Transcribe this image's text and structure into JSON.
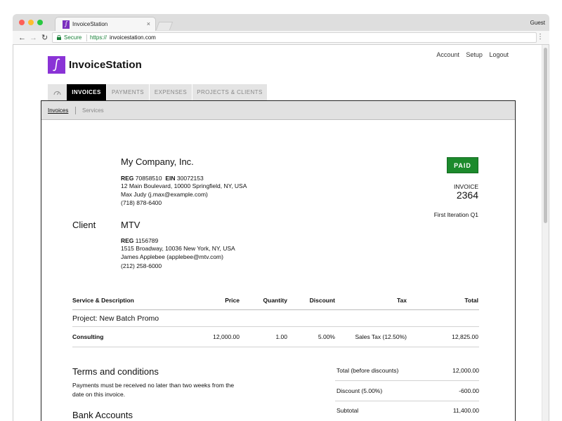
{
  "browser": {
    "tab_title": "InvoiceStation",
    "tab_close": "×",
    "profile": "Guest",
    "secure_label": "Secure",
    "url_scheme": "https://",
    "url_host": "invoicestation.com"
  },
  "app": {
    "brand": "InvoiceStation",
    "logo_glyph": "∫",
    "top_links": [
      "Account",
      "Setup",
      "Logout"
    ],
    "tabs": [
      "INVOICES",
      "PAYMENTS",
      "EXPENSES",
      "PROJECTS & CLIENTS"
    ],
    "subnav": [
      "Invoices",
      "Services"
    ]
  },
  "invoice": {
    "status": "PAID",
    "label": "INVOICE",
    "number": "2364",
    "title": "First Iteration Q1",
    "company": {
      "name": "My Company, Inc.",
      "reg_label": "REG",
      "reg": "70858510",
      "ein_label": "EIN",
      "ein": "30072153",
      "address": "12 Main Boulevard, 10000 Springfield, NY, USA",
      "contact": "Max Judy (j.max@example.com)",
      "phone": "(718) 878-6400"
    },
    "client_label": "Client",
    "client": {
      "name": "MTV",
      "reg_label": "REG",
      "reg": "1156789",
      "address": "1515 Broadway, 10036 New York, NY, USA",
      "contact": "James Applebee (applebee@mtv.com)",
      "phone": "(212) 258-6000"
    },
    "table": {
      "headers": {
        "service": "Service & Description",
        "price": "Price",
        "quantity": "Quantity",
        "discount": "Discount",
        "tax": "Tax",
        "total": "Total"
      },
      "project": "Project: New Batch Promo",
      "rows": [
        {
          "service": "Consulting",
          "price": "12,000.00",
          "quantity": "1.00",
          "discount": "5.00%",
          "tax": "Sales Tax (12.50%)",
          "total": "12,825.00"
        }
      ]
    },
    "terms": {
      "title": "Terms and conditions",
      "body": "Payments must be received no later than two weeks from the date on this invoice."
    },
    "bank_title": "Bank Accounts",
    "summary": [
      {
        "label": "Total (before discounts)",
        "value": "12,000.00"
      },
      {
        "label": "Discount (5.00%)",
        "value": "-600.00"
      },
      {
        "label": "Subtotal",
        "value": "11,400.00"
      }
    ]
  },
  "colors": {
    "brand_purple": "#8a33d6",
    "paid_green": "#1c8a2c",
    "secure_green": "#188038",
    "active_tab": "#000000"
  }
}
